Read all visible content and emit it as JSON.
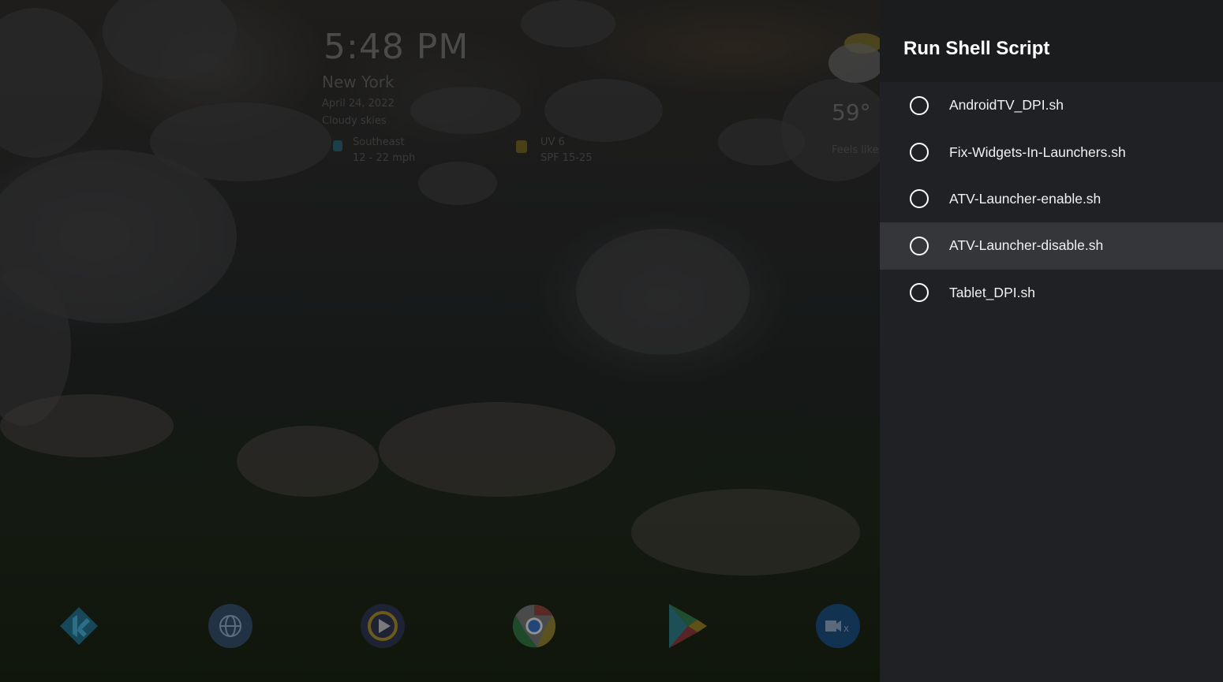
{
  "background": {
    "clock": "5:48 PM",
    "city": "New York",
    "date": "April 24, 2022",
    "condition": "Cloudy skies",
    "wind": {
      "direction": "Southeast",
      "speed": "12 - 22 mph"
    },
    "uv": {
      "index": "UV 6",
      "spf": "SPF 15-25"
    },
    "temperature": "59°",
    "feels_like": "Feels like"
  },
  "dock": {
    "apps": [
      {
        "name": "kodi-icon"
      },
      {
        "name": "globe-headset-icon"
      },
      {
        "name": "player-icon"
      },
      {
        "name": "chrome-icon"
      },
      {
        "name": "play-store-icon"
      },
      {
        "name": "mx-player-icon"
      }
    ]
  },
  "panel": {
    "title": "Run Shell Script",
    "options": [
      {
        "label": "AndroidTV_DPI.sh",
        "selected": false
      },
      {
        "label": "Fix-Widgets-In-Launchers.sh",
        "selected": false
      },
      {
        "label": "ATV-Launcher-enable.sh",
        "selected": false
      },
      {
        "label": "ATV-Launcher-disable.sh",
        "selected": false,
        "focused": true
      },
      {
        "label": "Tablet_DPI.sh",
        "selected": false
      }
    ]
  }
}
